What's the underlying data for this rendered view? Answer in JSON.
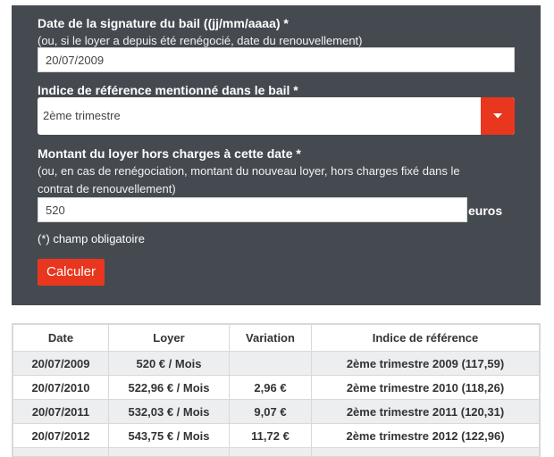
{
  "form": {
    "date_label": "Date de la signature du bail ((jj/mm/aaaa) *",
    "date_hint": "(ou, si le loyer a depuis été renégocié, date du renouvellement)",
    "date_value": "20/07/2009",
    "index_label": "Indice de référence mentionné dans le bail *",
    "index_selected": "2ème trimestre",
    "amount_label": "Montant du loyer hors charges à cette date *",
    "amount_hint_1": "(ou, en cas de renégociation, montant du nouveau loyer, hors charges fixé dans le",
    "amount_hint_2": "contrat de renouvellement)",
    "amount_value": "520",
    "amount_unit": "euros",
    "required_note": "(*) champ obligatoire",
    "submit_label": "Calculer"
  },
  "table": {
    "headers": [
      "Date",
      "Loyer",
      "Variation",
      "Indice de référence"
    ],
    "rows": [
      [
        "20/07/2009",
        "520 € / Mois",
        "",
        "2ème trimestre 2009 (117,59)"
      ],
      [
        "20/07/2010",
        "522,96 € / Mois",
        "2,96 €",
        "2ème trimestre 2010 (118,26)"
      ],
      [
        "20/07/2011",
        "532,03 € / Mois",
        "9,07 €",
        "2ème trimestre 2011 (120,31)"
      ],
      [
        "20/07/2012",
        "543,75 € / Mois",
        "11,72 €",
        "2ème trimestre 2012 (122,96)"
      ],
      [
        "",
        "",
        "",
        ""
      ]
    ]
  },
  "colors": {
    "panel_bg": "#454a51",
    "accent": "#e8371e",
    "row_alt": "#eceeef"
  },
  "icons": {
    "dropdown": "caret-down-icon"
  }
}
